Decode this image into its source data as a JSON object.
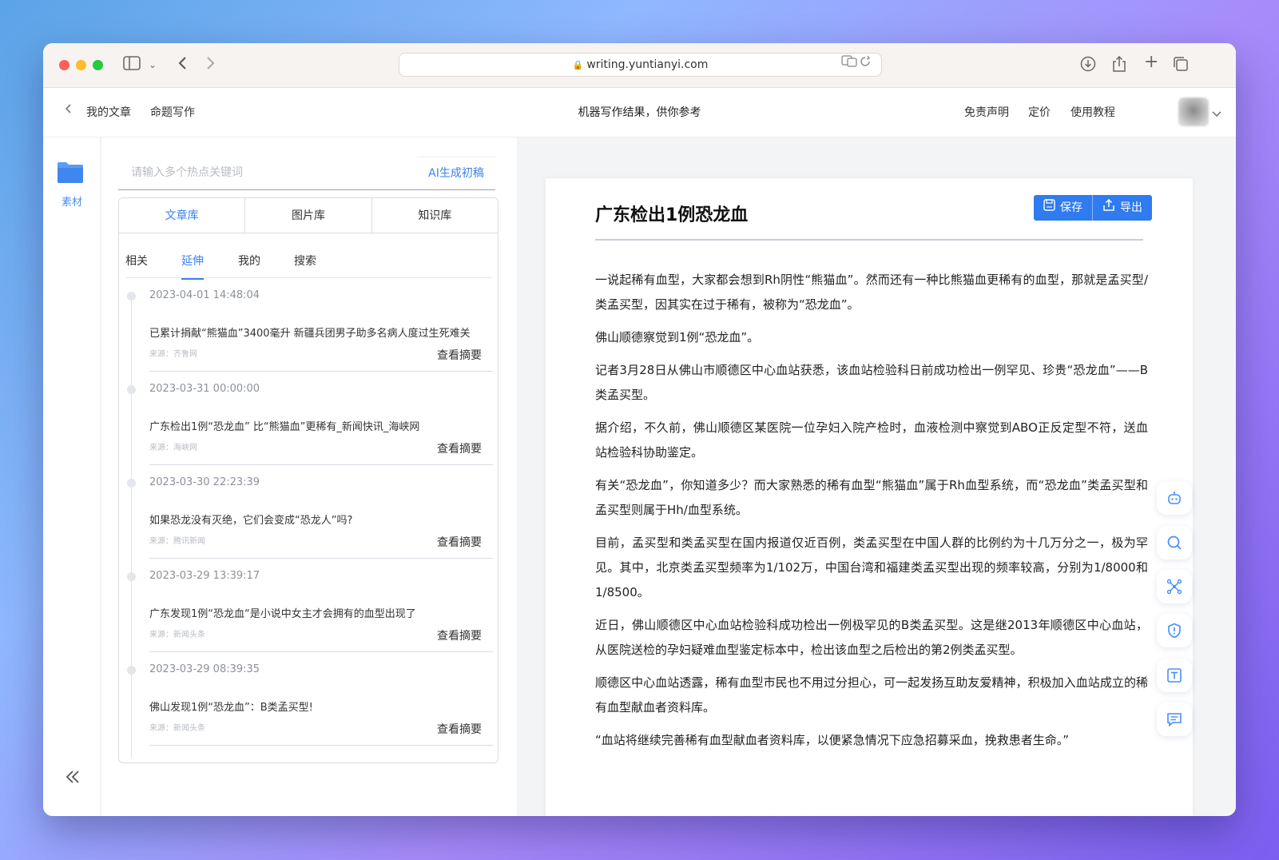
{
  "browser": {
    "url": "writing.yuntianyi.com"
  },
  "header": {
    "nav": [
      "我的文章",
      "命题写作"
    ],
    "center_text": "机器写作结果，供你参考",
    "links": [
      "免责声明",
      "定价",
      "使用教程"
    ]
  },
  "rail": {
    "item_label": "素材"
  },
  "search": {
    "placeholder": "请输入多个热点关键词",
    "ai_button": "AI生成初稿"
  },
  "library": {
    "tabs": [
      "文章库",
      "图片库",
      "知识库"
    ],
    "active_tab": 0,
    "sub_tabs": [
      "相关",
      "延伸",
      "我的",
      "搜索"
    ],
    "active_sub_tab": 1,
    "items": [
      {
        "date": "2023-04-01 14:48:04",
        "title": "已累计捐献“熊猫血”3400毫升 新疆兵团男子助多名病人度过生死难关",
        "source": "来源：齐鲁网",
        "action": "查看摘要"
      },
      {
        "date": "2023-03-31 00:00:00",
        "title": "广东检出1例“恐龙血” 比“熊猫血”更稀有_新闻快讯_海峡网",
        "source": "来源：海峡网",
        "action": "查看摘要"
      },
      {
        "date": "2023-03-30 22:23:39",
        "title": "如果恐龙没有灭绝，它们会变成“恐龙人”吗?",
        "source": "来源：腾讯新闻",
        "action": "查看摘要"
      },
      {
        "date": "2023-03-29 13:39:17",
        "title": "广东发现1例“恐龙血“是小说中女主才会拥有的血型出现了",
        "source": "来源：新闻头条",
        "action": "查看摘要"
      },
      {
        "date": "2023-03-29 08:39:35",
        "title": "佛山发现1例“恐龙血”：B类孟买型!",
        "source": "来源：新闻头条",
        "action": "查看摘要"
      }
    ]
  },
  "document": {
    "title": "广东检出1例恐龙血",
    "save_label": "保存",
    "export_label": "导出",
    "paragraphs": [
      "一说起稀有血型，大家都会想到Rh阴性“熊猫血”。然而还有一种比熊猫血更稀有的血型，那就是孟买型/类孟买型，因其实在过于稀有，被称为“恐龙血”。",
      "佛山顺德察觉到1例“恐龙血”。",
      "记者3月28日从佛山市顺德区中心血站获悉，该血站检验科日前成功检出一例罕见、珍贵“恐龙血”——B类孟买型。",
      "据介绍，不久前，佛山顺德区某医院一位孕妇入院产检时，血液检测中察觉到ABO正反定型不符，送血站检验科协助鉴定。",
      "有关“恐龙血”，你知道多少？而大家熟悉的稀有血型“熊猫血”属于Rh血型系统，而“恐龙血”类孟买型和孟买型则属于Hh/血型系统。",
      "目前，孟买型和类孟买型在国内报道仅近百例，类孟买型在中国人群的比例约为十几万分之一，极为罕见。其中，北京类孟买型频率为1/102万，中国台湾和福建类孟买型出现的频率较高，分别为1/8000和1/8500。",
      "近日，佛山顺德区中心血站检验科成功检出一例极罕见的B类孟买型。这是继2013年顺德区中心血站，从医院送检的孕妇疑难血型鉴定标本中，检出该血型之后检出的第2例类孟买型。",
      "顺德区中心血站透露，稀有血型市民也不用过分担心，可一起发扬互助友爱精神，积极加入血站成立的稀有血型献血者资料库。",
      "“血站将继续完善稀有血型献血者资料库，以便紧急情况下应急招募采血，挽救患者生命。”"
    ]
  },
  "tools": [
    "robot-icon",
    "search-icon",
    "network-icon",
    "shield-icon",
    "text-icon",
    "comment-icon"
  ],
  "colors": {
    "accent": "#3a82f2",
    "button": "#2f7bf0"
  }
}
